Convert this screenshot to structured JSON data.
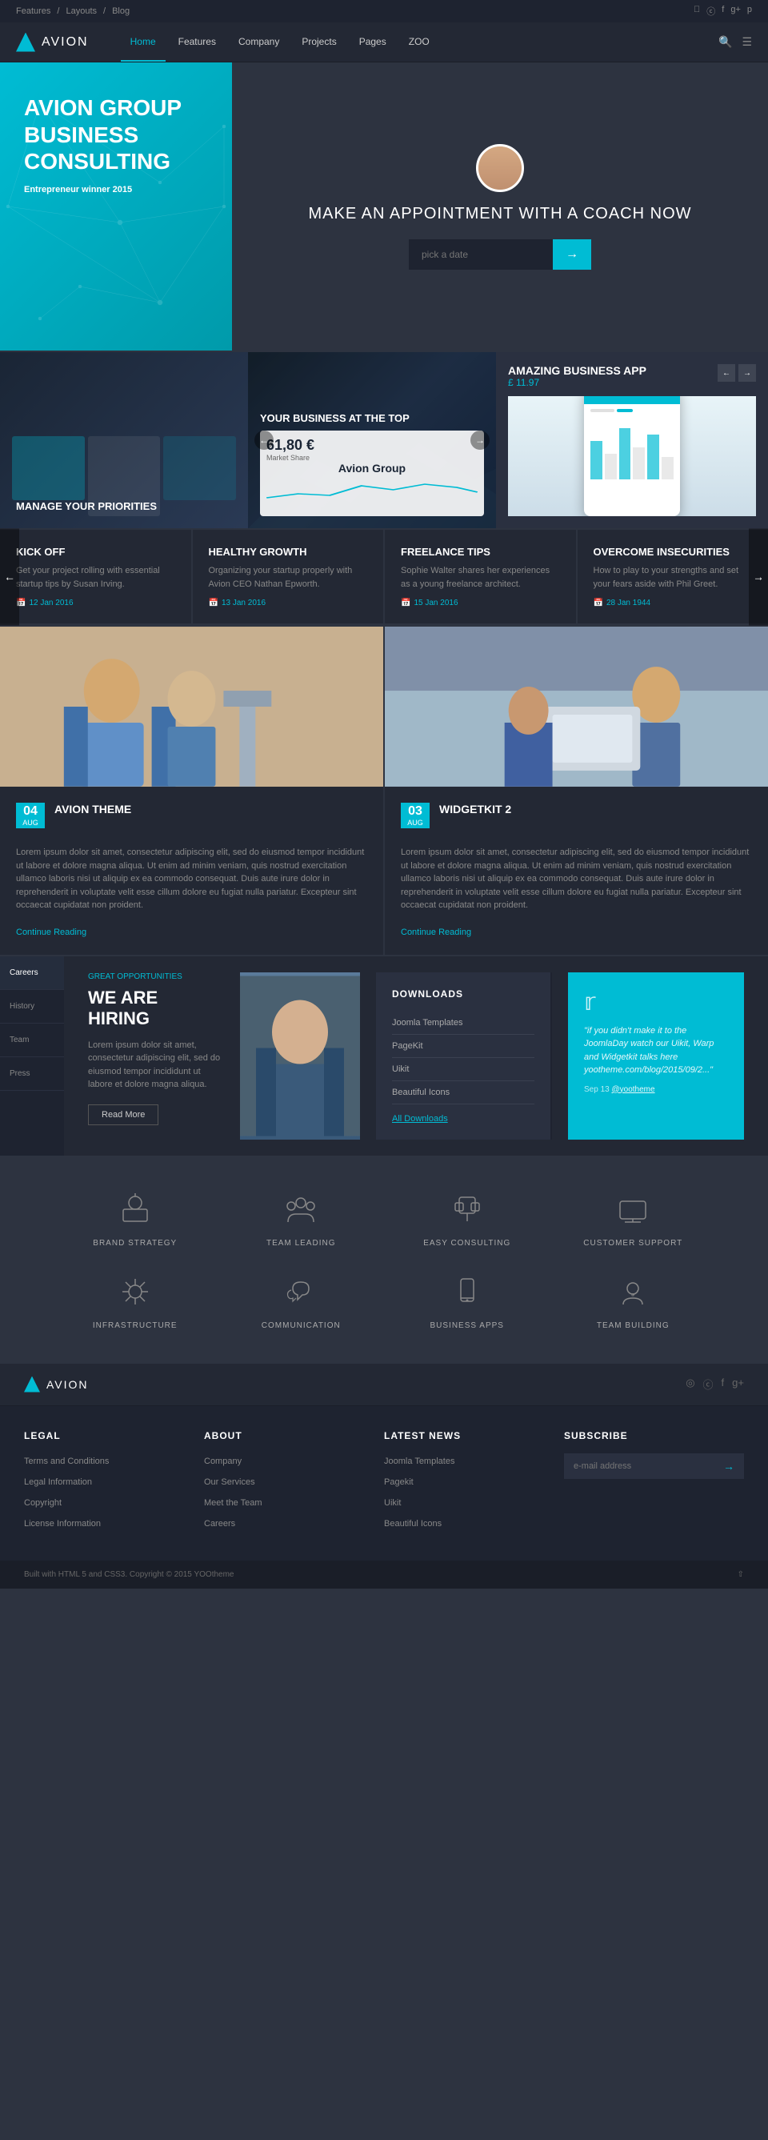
{
  "topbar": {
    "breadcrumbs": [
      "Features",
      "Layouts",
      "Blog"
    ],
    "social_icons": [
      "github-icon",
      "twitter-icon",
      "facebook-icon",
      "google-plus-icon",
      "pinterest-icon"
    ]
  },
  "nav": {
    "logo": "AVION",
    "links": [
      {
        "label": "Home",
        "active": true
      },
      {
        "label": "Features",
        "active": false
      },
      {
        "label": "Company",
        "active": false
      },
      {
        "label": "Projects",
        "active": false
      },
      {
        "label": "Pages",
        "active": false
      },
      {
        "label": "ZOO",
        "active": false
      }
    ]
  },
  "hero": {
    "title": "AVION GROUP BUSINESS CONSULTING",
    "subtitle_prefix": "Entrepreneur",
    "subtitle_suffix": "winner 2015",
    "coach_heading": "MAKE AN APPOINTMENT WITH A COACH NOW",
    "date_placeholder": "pick a date"
  },
  "slider": {
    "slide1": {
      "text": "MANAGE YOUR PRIORITIES"
    },
    "slide2": {
      "text": "YOUR BUSINESS AT THE TOP",
      "value": "61,80 €",
      "company": "Avion Group",
      "chart_label": "Market Share"
    },
    "slide3": {
      "title": "AMAZING BUSINESS APP",
      "price": "£ 11.97"
    }
  },
  "blog_cards": [
    {
      "title": "KICK OFF",
      "text": "Get your project rolling with essential startup tips by Susan Irving.",
      "date": "12 Jan 2016"
    },
    {
      "title": "HEALTHY GROWTH",
      "text": "Organizing your startup properly with Avion CEO Nathan Epworth.",
      "date": "13 Jan 2016"
    },
    {
      "title": "FREELANCE TIPS",
      "text": "Sophie Walter shares her experiences as a young freelance architect.",
      "date": "15 Jan 2016"
    },
    {
      "title": "OVERCOME INSECURITIES",
      "text": "How to play to your strengths and set your fears aside with Phil Greet.",
      "date": "28 Jan 1944"
    }
  ],
  "posts": [
    {
      "day": "04",
      "month": "AUG",
      "title": "AVION THEME",
      "text": "Lorem ipsum dolor sit amet, consectetur adipiscing elit, sed do eiusmod tempor incididunt ut labore et dolore magna aliqua. Ut enim ad minim veniam, quis nostrud exercitation ullamco laboris nisi ut aliquip ex ea commodo consequat. Duis aute irure dolor in reprehenderit in voluptate velit esse cillum dolore eu fugiat nulla pariatur. Excepteur sint occaecat cupidatat non proident.",
      "read_more": "Continue Reading"
    },
    {
      "day": "03",
      "month": "AUG",
      "title": "WIDGETKIT 2",
      "text": "Lorem ipsum dolor sit amet, consectetur adipiscing elit, sed do eiusmod tempor incididunt ut labore et dolore magna aliqua. Ut enim ad minim veniam, quis nostrud exercitation ullamco laboris nisi ut aliquip ex ea commodo consequat. Duis aute irure dolor in reprehenderit in voluptate velit esse cillum dolore eu fugiat nulla pariatur. Excepteur sint occaecat cupidatat non proident.",
      "read_more": "Continue Reading"
    }
  ],
  "sidebar": {
    "nav_items": [
      "Careers",
      "History",
      "Team",
      "Press"
    ],
    "tag": "Great opportunities",
    "title": "WE ARE HIRING",
    "text": "Lorem ipsum dolor sit amet, consectetur adipiscing elit, sed do eiusmod tempor incididunt ut labore et dolore magna aliqua.",
    "btn_label": "Read More"
  },
  "downloads": {
    "title": "DOWNLOADS",
    "items": [
      "Joomla Templates",
      "PageKit",
      "Uikit",
      "Beautiful Icons"
    ],
    "all_label": "All Downloads"
  },
  "twitter": {
    "quote": "\"if you didn't make it to the JoomlaDay watch our Uikit, Warp and Widgetkit talks here yootheme.com/blog/2015/09/2...\"",
    "date": "Sep 13",
    "handle": "@yootheme"
  },
  "services": [
    {
      "icon": "♟",
      "label": "BRAND STRATEGY"
    },
    {
      "icon": "👥",
      "label": "TEAM LEADING"
    },
    {
      "icon": "🧩",
      "label": "EASY CONSULTING"
    },
    {
      "icon": "💻",
      "label": "CUSTOMER SUPPORT"
    },
    {
      "icon": "⚙",
      "label": "INFRASTRUCTURE"
    },
    {
      "icon": "📡",
      "label": "COMMUNICATION"
    },
    {
      "icon": "📱",
      "label": "BUSINESS APPS"
    },
    {
      "icon": "☺",
      "label": "TEAM BUILDING"
    }
  ],
  "footer": {
    "logo": "AVION",
    "sections": {
      "legal": {
        "title": "LEGAL",
        "links": [
          "Terms and Conditions",
          "Legal Information",
          "Copyright",
          "License Information"
        ]
      },
      "about": {
        "title": "ABOUT",
        "links": [
          "Company",
          "Our Services",
          "Meet the Team",
          "Careers"
        ]
      },
      "news": {
        "title": "LATEST NEWS",
        "links": [
          "Joomla Templates",
          "Pagekit",
          "Uikit",
          "Beautiful Icons"
        ]
      },
      "subscribe": {
        "title": "SUBSCRIBE",
        "placeholder": "e-mail address"
      }
    },
    "bottom": "Built with HTML 5 and CSS3. Copyright © 2015 YOOtheme"
  }
}
